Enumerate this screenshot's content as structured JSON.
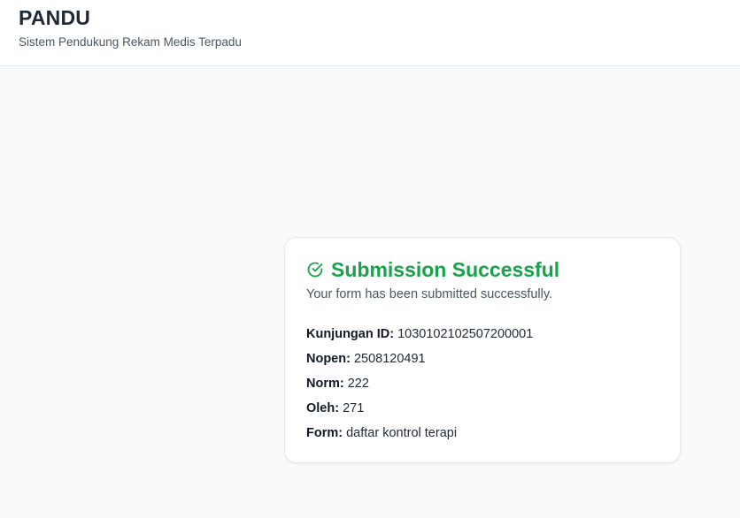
{
  "header": {
    "title": "PANDU",
    "subtitle": "Sistem Pendukung Rekam Medis Terpadu"
  },
  "result": {
    "icon": "check-circle-icon",
    "title": "Submission Successful",
    "message": "Your form has been submitted successfully.",
    "accent_color": "#16a34a",
    "details": [
      {
        "label": "Kunjungan ID:",
        "value": "1030102102507200001"
      },
      {
        "label": "Nopen:",
        "value": "2508120491"
      },
      {
        "label": "Norm:",
        "value": "222"
      },
      {
        "label": "Oleh:",
        "value": "271"
      },
      {
        "label": "Form:",
        "value": "daftar kontrol terapi"
      }
    ]
  }
}
